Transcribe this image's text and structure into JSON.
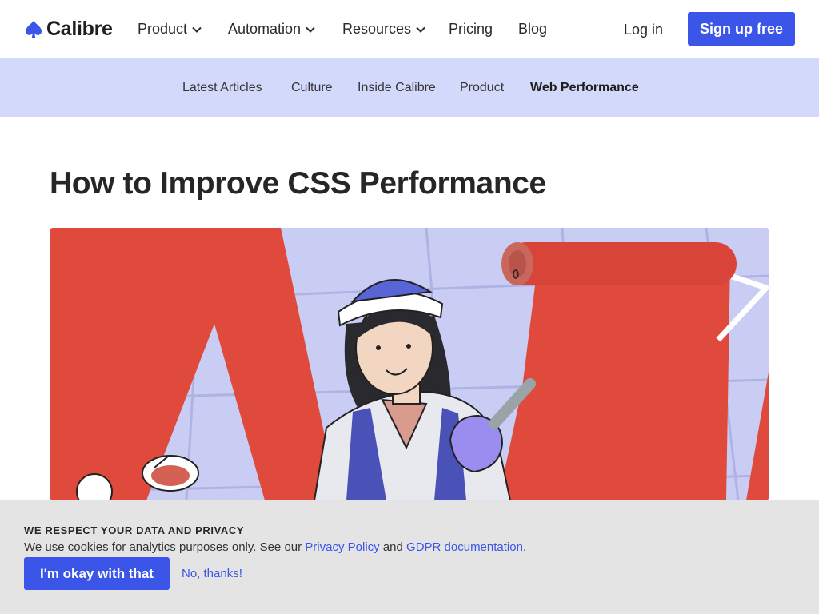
{
  "brand": {
    "name": "Calibre",
    "icon": "spade-icon",
    "accent": "#3a55e8"
  },
  "nav": {
    "items": [
      {
        "label": "Product",
        "has_dropdown": true
      },
      {
        "label": "Automation",
        "has_dropdown": true
      },
      {
        "label": "Resources",
        "has_dropdown": true
      },
      {
        "label": "Pricing",
        "has_dropdown": false
      },
      {
        "label": "Blog",
        "has_dropdown": false
      }
    ],
    "login": "Log in",
    "signup": "Sign up free"
  },
  "categories": {
    "items": [
      "Latest Articles",
      "Culture",
      "Inside Calibre",
      "Product",
      "Web Performance"
    ],
    "active": "Web Performance",
    "background": "#d3d9fa"
  },
  "article": {
    "title": "How to Improve CSS Performance",
    "hero_icon": "painter-illustration"
  },
  "cookie": {
    "heading": "WE RESPECT YOUR DATA AND PRIVACY",
    "text_before": "We use cookies for analytics purposes only. See our ",
    "privacy_link": "Privacy Policy",
    "text_mid": " and ",
    "gdpr_link": "GDPR documentation",
    "text_after": ".",
    "accept": "I'm okay with that",
    "decline": "No, thanks!"
  }
}
